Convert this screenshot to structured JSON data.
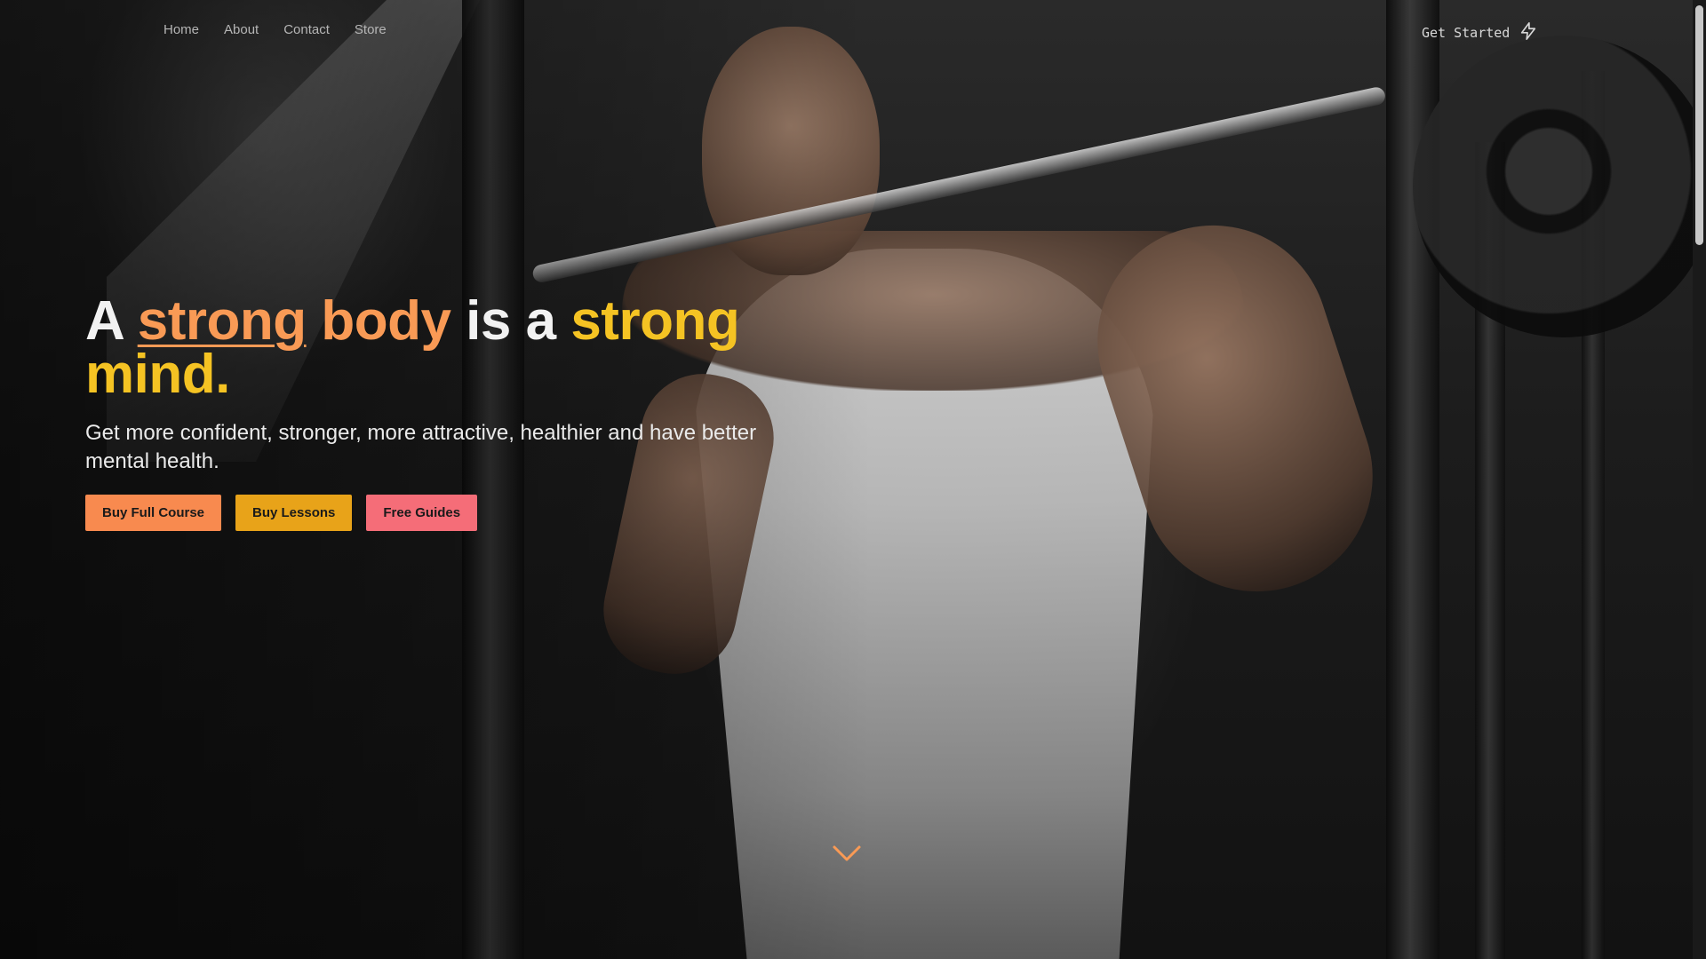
{
  "nav": {
    "links": [
      "Home",
      "About",
      "Contact",
      "Store"
    ],
    "cta_label": "Get Started",
    "cta_icon": "lightning-bolt-icon"
  },
  "hero": {
    "headline_parts": {
      "a": "A",
      "strong1": "strong",
      "body": "body",
      "is_a": "is a",
      "strong2": "strong",
      "mind": "mind."
    },
    "subheadline": "Get more confident, stronger, more attractive, healthier and have better mental health.",
    "buttons": {
      "full_course": "Buy Full Course",
      "lessons": "Buy Lessons",
      "guides": "Free Guides"
    },
    "scroll_icon": "chevron-down-icon"
  },
  "colors": {
    "orange": "#f99a55",
    "amber": "#e8a319",
    "yellow": "#f5c323",
    "pink": "#f56d78",
    "background": "#141414"
  }
}
